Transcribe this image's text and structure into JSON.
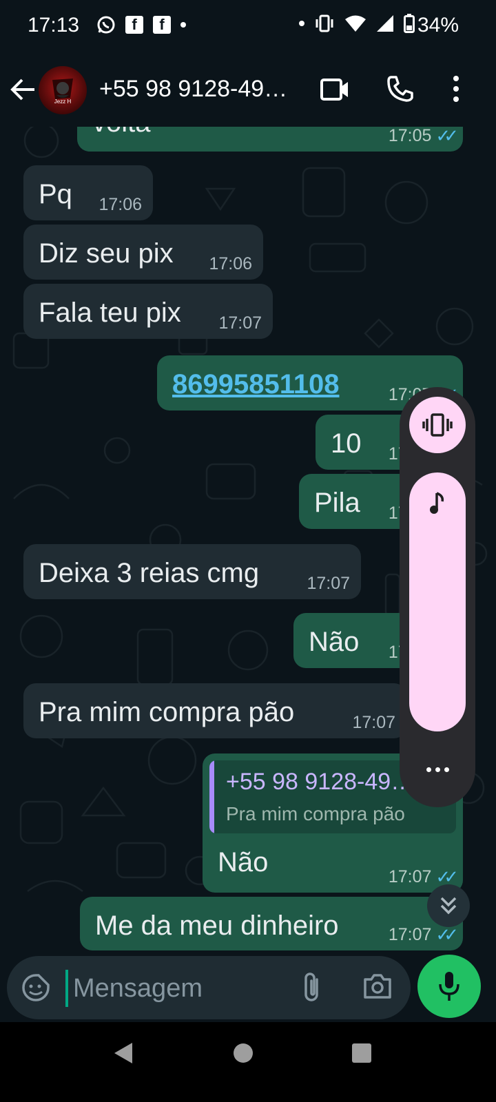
{
  "status_bar": {
    "time": "17:13",
    "battery": "34%",
    "left_icons": [
      "whatsapp-icon",
      "facebook-icon",
      "facebook-icon"
    ],
    "right_icons": [
      "vibrate-icon",
      "wifi-icon",
      "signal-icon",
      "battery-icon"
    ]
  },
  "header": {
    "contact": "+55 98 9128-49…",
    "avatar_label": "Jezz H"
  },
  "messages": [
    {
      "dir": "out",
      "text": "volta",
      "time": "17:05",
      "read": true
    },
    {
      "dir": "in",
      "text": "Pq",
      "time": "17:06"
    },
    {
      "dir": "in",
      "text": "Diz seu pix",
      "time": "17:06"
    },
    {
      "dir": "in",
      "text": "Fala teu pix",
      "time": "17:07"
    },
    {
      "dir": "out",
      "text": "86995851108",
      "time": "17:07",
      "link": true,
      "read": true
    },
    {
      "dir": "out",
      "text": "10",
      "time": "17:07",
      "read": true
    },
    {
      "dir": "out",
      "text": "Pila",
      "time": "17:07",
      "read": true
    },
    {
      "dir": "in",
      "text": "Deixa 3 reias cmg",
      "time": "17:07"
    },
    {
      "dir": "out",
      "text": "Não",
      "time": "17:07",
      "read": true
    },
    {
      "dir": "in",
      "text": "Pra mim compra pão",
      "time": "17:07"
    },
    {
      "dir": "out",
      "text": "Não",
      "time": "17:07",
      "read": true,
      "reply_to": {
        "name": "+55 98 9128-49…",
        "text": "Pra mim compra pão"
      }
    },
    {
      "dir": "out",
      "text": "Me da meu dinheiro",
      "time": "17:07",
      "read": true
    }
  ],
  "input": {
    "placeholder": "Mensagem"
  },
  "volume_panel": {
    "mode": "vibrate",
    "stream": "music",
    "level": 1.0
  },
  "colors": {
    "background": "#0b141a",
    "incoming_bubble": "#202c33",
    "outgoing_bubble": "#1f5a47",
    "accent_green": "#21c063",
    "read_tick": "#53bdeb",
    "volume_accent": "#ffd6f6"
  }
}
